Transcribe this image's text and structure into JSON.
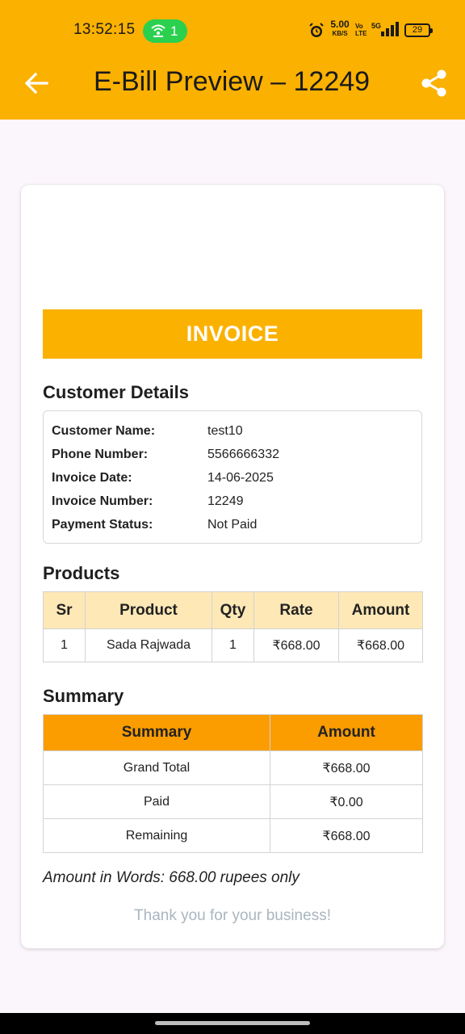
{
  "status_bar": {
    "time": "13:52:15",
    "hotspot_count": "1",
    "net_speed": "5.00",
    "net_speed_unit": "KB/S",
    "volte_top": "Vo",
    "volte_bottom": "LTE",
    "network": "5G",
    "battery": "29"
  },
  "app_bar": {
    "title": "E-Bill Preview – 12249",
    "back_icon": "arrow-left-icon",
    "share_icon": "share-icon",
    "background": "#fbb100"
  },
  "invoice": {
    "banner": "INVOICE",
    "customer_section_title": "Customer Details",
    "customer_details": [
      {
        "label": "Customer Name:",
        "value": "test10"
      },
      {
        "label": "Phone Number:",
        "value": "5566666332"
      },
      {
        "label": "Invoice Date:",
        "value": "14-06-2025"
      },
      {
        "label": "Invoice Number:",
        "value": "12249"
      },
      {
        "label": "Payment Status:",
        "value": "Not Paid"
      }
    ],
    "products_section_title": "Products",
    "products_headers": [
      "Sr",
      "Product",
      "Qty",
      "Rate",
      "Amount"
    ],
    "products_rows": [
      [
        "1",
        "Sada Rajwada",
        "1",
        "₹668.00",
        "₹668.00"
      ]
    ],
    "summary_section_title": "Summary",
    "summary_headers": [
      "Summary",
      "Amount"
    ],
    "summary_rows": [
      [
        "Grand Total",
        "₹668.00"
      ],
      [
        "Paid",
        "₹0.00"
      ],
      [
        "Remaining",
        "₹668.00"
      ]
    ],
    "amount_in_words": "Amount in Words: 668.00 rupees only",
    "thank_you": "Thank you for your business!"
  }
}
